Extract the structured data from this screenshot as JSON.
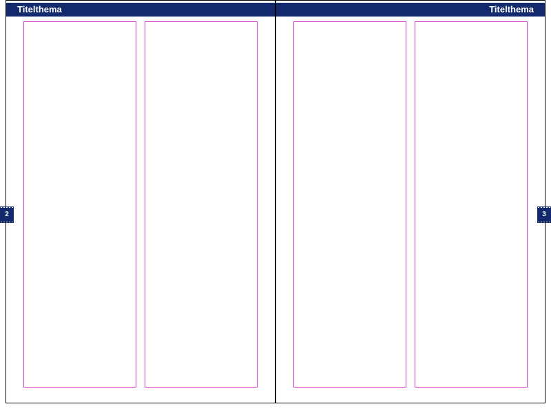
{
  "spread": {
    "left_page": {
      "header": "Titelthema",
      "page_number": "2"
    },
    "right_page": {
      "header": "Titelthema",
      "page_number": "3"
    }
  },
  "colors": {
    "header_bg": "#122a6d",
    "guide": "#d63fd6"
  }
}
